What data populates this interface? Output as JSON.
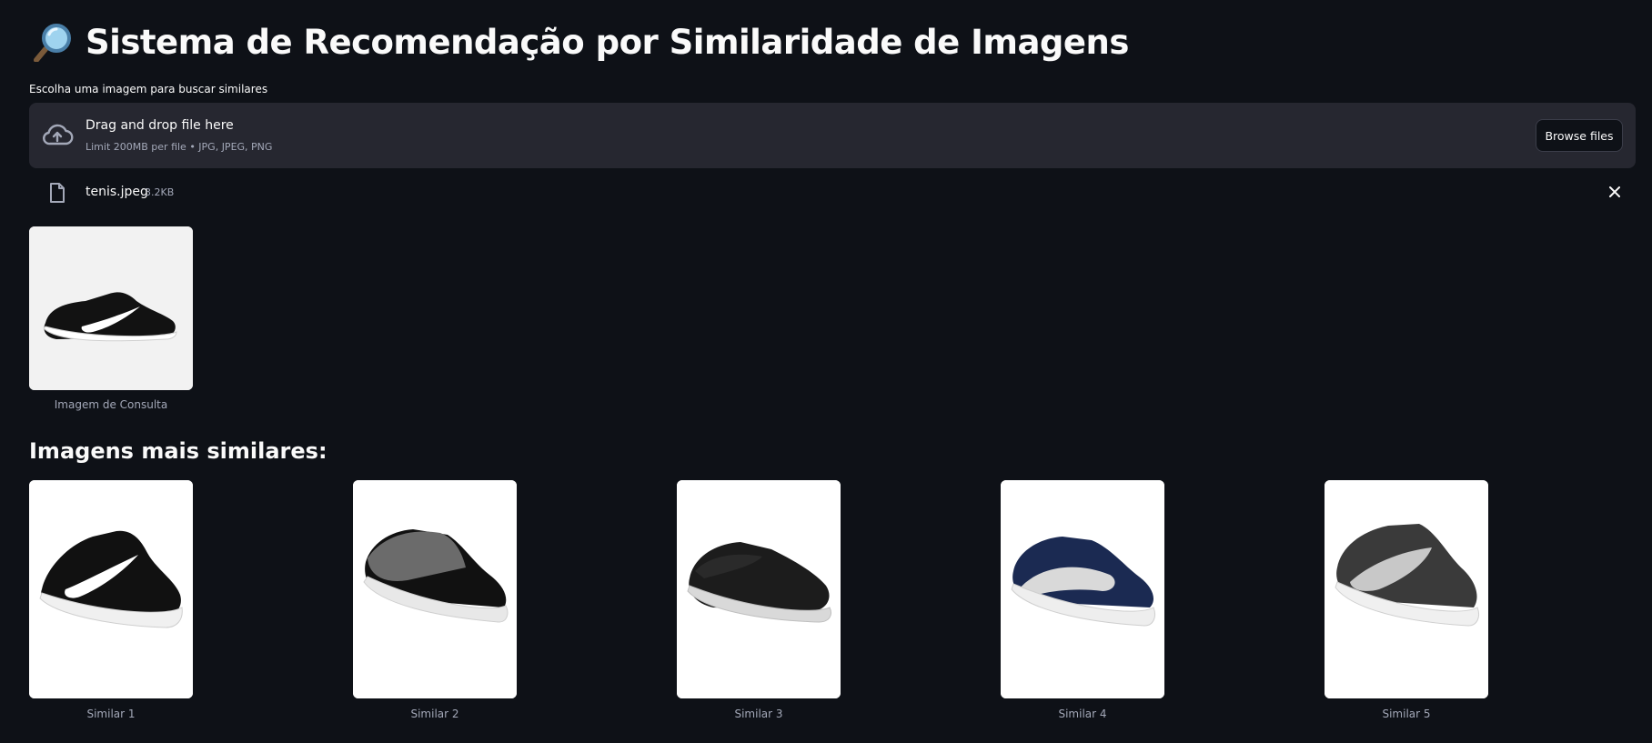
{
  "page": {
    "title": "Sistema de Recomendação por Similaridade de Imagens",
    "title_icon": "magnifying-glass-icon"
  },
  "uploader": {
    "label": "Escolha uma imagem para buscar similares",
    "drop_text": "Drag and drop file here",
    "limit_text": "Limit 200MB per file • JPG, JPEG, PNG",
    "browse_label": "Browse files",
    "icon": "cloud-upload-icon"
  },
  "uploaded_file": {
    "name": "tenis.jpeg",
    "size": "3.2KB",
    "icon": "file-icon",
    "remove_icon": "close-icon"
  },
  "query": {
    "caption": "Imagem de Consulta",
    "colors": {
      "bg": "#f2f2f2",
      "shoe": "#121212",
      "sole": "#ffffff",
      "swoosh": "#ffffff"
    }
  },
  "results": {
    "heading": "Imagens mais similares:",
    "items": [
      {
        "caption": "Similar 1",
        "colors": {
          "body": "#111111",
          "accent": "#ffffff",
          "sole": "#f0f0f0"
        }
      },
      {
        "caption": "Similar 2",
        "colors": {
          "body": "#111111",
          "accent": "#6b6b6b",
          "sole": "#e8e8e8"
        }
      },
      {
        "caption": "Similar 3",
        "colors": {
          "body": "#1c1c1c",
          "accent": "#2a2a2a",
          "sole": "#d9d9d9"
        }
      },
      {
        "caption": "Similar 4",
        "colors": {
          "body": "#1b2a52",
          "accent": "#d9d9d9",
          "sole": "#eeeeee"
        }
      },
      {
        "caption": "Similar 5",
        "colors": {
          "body": "#3a3a3a",
          "accent": "#c8c8c8",
          "sole": "#f0f0f0"
        }
      }
    ]
  },
  "theme": {
    "background": "#0e1117",
    "panel": "#262730",
    "text": "#fafafa",
    "muted": "#a3a8b8"
  }
}
